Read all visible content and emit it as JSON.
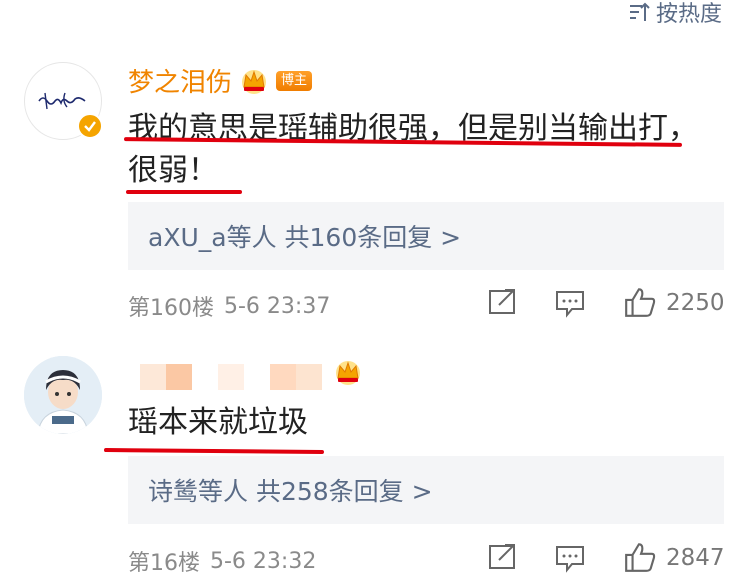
{
  "sort": {
    "label": "按热度",
    "icon": "sort-icon"
  },
  "comments": [
    {
      "username": "梦之泪伤",
      "badge": "博主",
      "avatar_icon": "signature-avatar",
      "text_line1": "我的意思是瑶辅助很强，但是别当输出打，",
      "text_line2": "很弱！",
      "replies": "aXU_a等人  共160条回复 >",
      "floor": "第160楼",
      "time": "5-6 23:37",
      "likes": "2250"
    },
    {
      "username": "",
      "avatar_icon": "cartoon-boy-avatar",
      "text_line1": "瑶本来就垃圾",
      "replies": "诗鸶等人  共258条回复 >",
      "floor": "第16楼",
      "time": "5-6 23:32",
      "likes": "2847"
    }
  ],
  "colors": {
    "accent_orange": "#f08400",
    "link_blue": "#5a6b86",
    "underline_red": "#e0000e",
    "reply_bg": "#f4f5f7"
  }
}
